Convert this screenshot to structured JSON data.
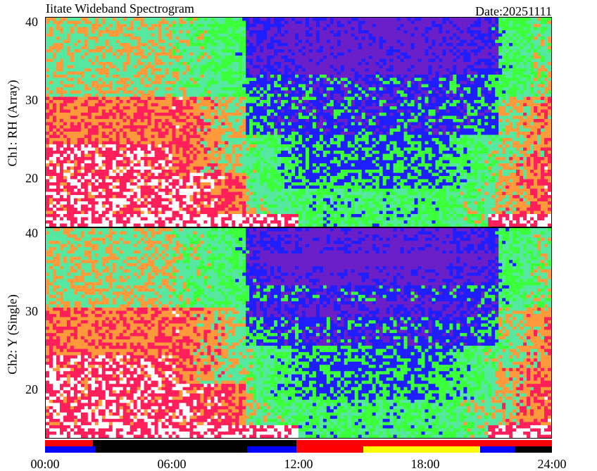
{
  "title": "Iitate Wideband Spectrogram",
  "date_label": "Date:20251111",
  "chart_data": [
    {
      "type": "heatmap",
      "panel": "ch1",
      "ylabel": "Ch1: RH (Array)",
      "yticks": [
        20,
        30,
        40
      ],
      "ylim": [
        13,
        40.5
      ],
      "xlim": [
        0,
        24
      ],
      "xlabel": "",
      "xticks": [
        "00:00",
        "06:00",
        "12:00",
        "18:00",
        "24:00"
      ],
      "colormap": [
        "#ffffff",
        "#ff1f5a",
        "#ff9a3c",
        "#56e8a0",
        "#3aff3a",
        "#1e1eff",
        "#6a1fc8"
      ],
      "grid": false
    },
    {
      "type": "heatmap",
      "panel": "ch2",
      "ylabel": "Ch2: Y (Single)",
      "yticks": [
        20,
        30,
        40
      ],
      "ylim": [
        13,
        40.5
      ],
      "xlim": [
        0,
        24
      ],
      "xlabel": "",
      "xticks": [
        "00:00",
        "06:00",
        "12:00",
        "18:00",
        "24:00"
      ],
      "colormap": [
        "#ffffff",
        "#ff1f5a",
        "#ff9a3c",
        "#56e8a0",
        "#3aff3a",
        "#1e1eff",
        "#6a1fc8"
      ],
      "grid": false
    }
  ],
  "status_bars": {
    "top": [
      {
        "start": 0.0,
        "end": 2.25,
        "color": "#ff0000"
      },
      {
        "start": 2.25,
        "end": 11.9,
        "color": "#000000"
      },
      {
        "start": 11.9,
        "end": 24.0,
        "color": "#ff0000"
      }
    ],
    "bottom": [
      {
        "start": 0.0,
        "end": 2.4,
        "color": "#0000ff"
      },
      {
        "start": 2.4,
        "end": 9.55,
        "color": "#000000"
      },
      {
        "start": 9.55,
        "end": 11.9,
        "color": "#0000ff"
      },
      {
        "start": 11.9,
        "end": 15.05,
        "color": "#ff0000"
      },
      {
        "start": 15.05,
        "end": 20.6,
        "color": "#ffff00"
      },
      {
        "start": 20.6,
        "end": 22.25,
        "color": "#0000ff"
      },
      {
        "start": 22.25,
        "end": 24.0,
        "color": "#000000"
      }
    ]
  }
}
